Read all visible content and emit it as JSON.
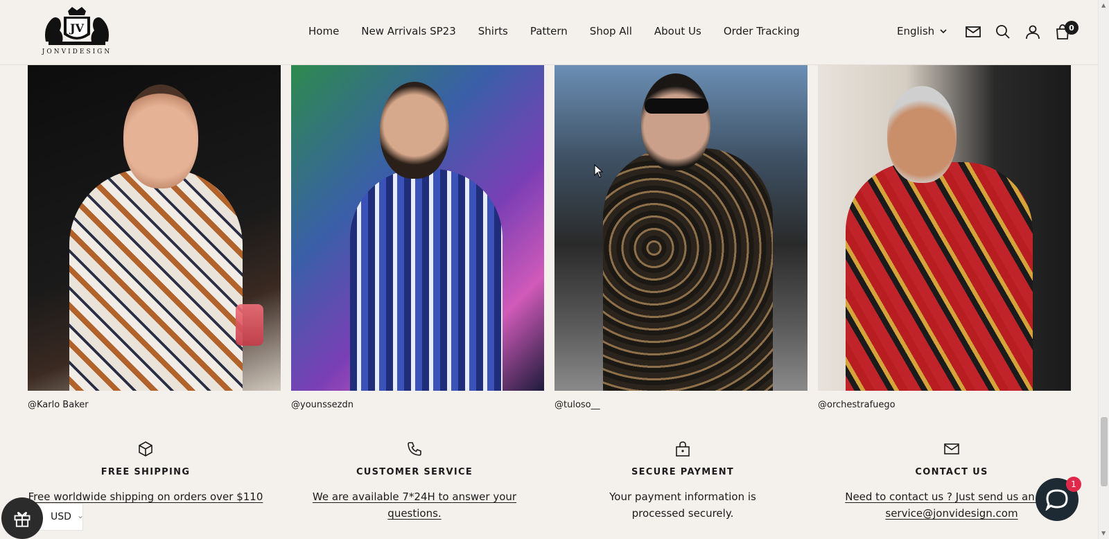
{
  "brand": {
    "name": "JONVIDESIGN",
    "monogram": "JV"
  },
  "nav": {
    "items": [
      {
        "label": "Home"
      },
      {
        "label": "New Arrivals SP23"
      },
      {
        "label": "Shirts"
      },
      {
        "label": "Pattern"
      },
      {
        "label": "Shop All"
      },
      {
        "label": "About Us"
      },
      {
        "label": "Order Tracking"
      }
    ]
  },
  "header": {
    "language": "English",
    "cart_count": "0",
    "icons": [
      "mail-icon",
      "search-icon",
      "account-icon",
      "cart-icon"
    ]
  },
  "gallery": [
    {
      "handle": "@Karlo Baker"
    },
    {
      "handle": "@younssezdn"
    },
    {
      "handle": "@tuloso__"
    },
    {
      "handle": "@orchestrafuego"
    }
  ],
  "features": [
    {
      "icon": "box-icon",
      "title": "FREE SHIPPING",
      "desc": "Free worldwide shipping on orders over $110"
    },
    {
      "icon": "phone-icon",
      "title": "CUSTOMER SERVICE",
      "desc": "We are available 7*24H to answer your questions."
    },
    {
      "icon": "lock-icon",
      "title": "SECURE PAYMENT",
      "desc": "Your payment information is processed securely."
    },
    {
      "icon": "mail-icon",
      "title": "CONTACT US",
      "desc_line1": "Need to contact us ? Just send us an e-m",
      "desc_line2": "service@jonvidesign.com"
    }
  ],
  "widgets": {
    "currency": "USD",
    "chat_badge": "1"
  },
  "colors": {
    "background": "#f4f1ed",
    "text": "#1c1b1b",
    "chat": "#1e2a33",
    "badge": "#e0294a"
  }
}
